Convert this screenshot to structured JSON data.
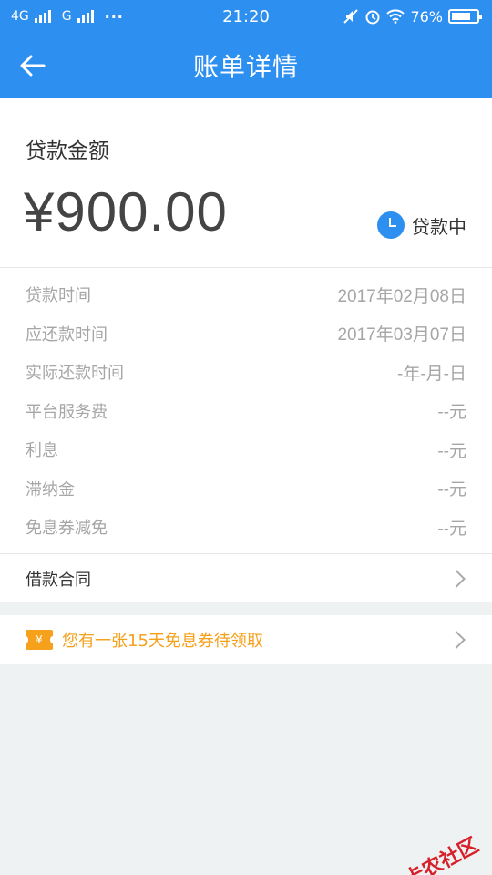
{
  "statusbar": {
    "net1": "4G",
    "net2": "G",
    "time": "21:20",
    "battery": "76%",
    "battery_level": 0.76
  },
  "header": {
    "title": "账单详情"
  },
  "summary": {
    "amount_label": "贷款金额",
    "amount": "¥900.00",
    "status": "贷款中"
  },
  "details": [
    {
      "label": "贷款时间",
      "value": "2017年02月08日"
    },
    {
      "label": "应还款时间",
      "value": "2017年03月07日"
    },
    {
      "label": "实际还款时间",
      "value": "-年-月-日"
    },
    {
      "label": "平台服务费",
      "value": "--元"
    },
    {
      "label": "利息",
      "value": "--元"
    },
    {
      "label": "滞纳金",
      "value": "--元"
    },
    {
      "label": "免息券减免",
      "value": "--元"
    }
  ],
  "contract": {
    "label": "借款合同"
  },
  "coupon": {
    "icon_symbol": "¥",
    "text": "您有一张15天免息券待领取"
  },
  "watermark": {
    "text": "卡农社区"
  },
  "colors": {
    "primary": "#2d8ff0",
    "coupon": "#f5a11c",
    "watermark": "#d8202a"
  }
}
